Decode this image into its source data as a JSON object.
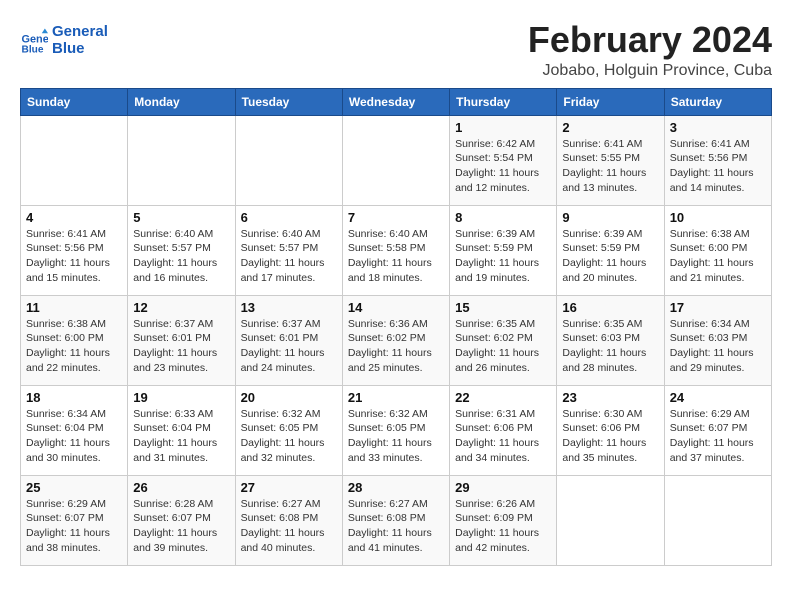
{
  "header": {
    "logo_line1": "General",
    "logo_line2": "Blue",
    "title": "February 2024",
    "subtitle": "Jobabo, Holguin Province, Cuba"
  },
  "calendar": {
    "weekdays": [
      "Sunday",
      "Monday",
      "Tuesday",
      "Wednesday",
      "Thursday",
      "Friday",
      "Saturday"
    ],
    "weeks": [
      [
        {
          "day": "",
          "info": ""
        },
        {
          "day": "",
          "info": ""
        },
        {
          "day": "",
          "info": ""
        },
        {
          "day": "",
          "info": ""
        },
        {
          "day": "1",
          "info": "Sunrise: 6:42 AM\nSunset: 5:54 PM\nDaylight: 11 hours and 12 minutes."
        },
        {
          "day": "2",
          "info": "Sunrise: 6:41 AM\nSunset: 5:55 PM\nDaylight: 11 hours and 13 minutes."
        },
        {
          "day": "3",
          "info": "Sunrise: 6:41 AM\nSunset: 5:56 PM\nDaylight: 11 hours and 14 minutes."
        }
      ],
      [
        {
          "day": "4",
          "info": "Sunrise: 6:41 AM\nSunset: 5:56 PM\nDaylight: 11 hours and 15 minutes."
        },
        {
          "day": "5",
          "info": "Sunrise: 6:40 AM\nSunset: 5:57 PM\nDaylight: 11 hours and 16 minutes."
        },
        {
          "day": "6",
          "info": "Sunrise: 6:40 AM\nSunset: 5:57 PM\nDaylight: 11 hours and 17 minutes."
        },
        {
          "day": "7",
          "info": "Sunrise: 6:40 AM\nSunset: 5:58 PM\nDaylight: 11 hours and 18 minutes."
        },
        {
          "day": "8",
          "info": "Sunrise: 6:39 AM\nSunset: 5:59 PM\nDaylight: 11 hours and 19 minutes."
        },
        {
          "day": "9",
          "info": "Sunrise: 6:39 AM\nSunset: 5:59 PM\nDaylight: 11 hours and 20 minutes."
        },
        {
          "day": "10",
          "info": "Sunrise: 6:38 AM\nSunset: 6:00 PM\nDaylight: 11 hours and 21 minutes."
        }
      ],
      [
        {
          "day": "11",
          "info": "Sunrise: 6:38 AM\nSunset: 6:00 PM\nDaylight: 11 hours and 22 minutes."
        },
        {
          "day": "12",
          "info": "Sunrise: 6:37 AM\nSunset: 6:01 PM\nDaylight: 11 hours and 23 minutes."
        },
        {
          "day": "13",
          "info": "Sunrise: 6:37 AM\nSunset: 6:01 PM\nDaylight: 11 hours and 24 minutes."
        },
        {
          "day": "14",
          "info": "Sunrise: 6:36 AM\nSunset: 6:02 PM\nDaylight: 11 hours and 25 minutes."
        },
        {
          "day": "15",
          "info": "Sunrise: 6:35 AM\nSunset: 6:02 PM\nDaylight: 11 hours and 26 minutes."
        },
        {
          "day": "16",
          "info": "Sunrise: 6:35 AM\nSunset: 6:03 PM\nDaylight: 11 hours and 28 minutes."
        },
        {
          "day": "17",
          "info": "Sunrise: 6:34 AM\nSunset: 6:03 PM\nDaylight: 11 hours and 29 minutes."
        }
      ],
      [
        {
          "day": "18",
          "info": "Sunrise: 6:34 AM\nSunset: 6:04 PM\nDaylight: 11 hours and 30 minutes."
        },
        {
          "day": "19",
          "info": "Sunrise: 6:33 AM\nSunset: 6:04 PM\nDaylight: 11 hours and 31 minutes."
        },
        {
          "day": "20",
          "info": "Sunrise: 6:32 AM\nSunset: 6:05 PM\nDaylight: 11 hours and 32 minutes."
        },
        {
          "day": "21",
          "info": "Sunrise: 6:32 AM\nSunset: 6:05 PM\nDaylight: 11 hours and 33 minutes."
        },
        {
          "day": "22",
          "info": "Sunrise: 6:31 AM\nSunset: 6:06 PM\nDaylight: 11 hours and 34 minutes."
        },
        {
          "day": "23",
          "info": "Sunrise: 6:30 AM\nSunset: 6:06 PM\nDaylight: 11 hours and 35 minutes."
        },
        {
          "day": "24",
          "info": "Sunrise: 6:29 AM\nSunset: 6:07 PM\nDaylight: 11 hours and 37 minutes."
        }
      ],
      [
        {
          "day": "25",
          "info": "Sunrise: 6:29 AM\nSunset: 6:07 PM\nDaylight: 11 hours and 38 minutes."
        },
        {
          "day": "26",
          "info": "Sunrise: 6:28 AM\nSunset: 6:07 PM\nDaylight: 11 hours and 39 minutes."
        },
        {
          "day": "27",
          "info": "Sunrise: 6:27 AM\nSunset: 6:08 PM\nDaylight: 11 hours and 40 minutes."
        },
        {
          "day": "28",
          "info": "Sunrise: 6:27 AM\nSunset: 6:08 PM\nDaylight: 11 hours and 41 minutes."
        },
        {
          "day": "29",
          "info": "Sunrise: 6:26 AM\nSunset: 6:09 PM\nDaylight: 11 hours and 42 minutes."
        },
        {
          "day": "",
          "info": ""
        },
        {
          "day": "",
          "info": ""
        }
      ]
    ]
  }
}
